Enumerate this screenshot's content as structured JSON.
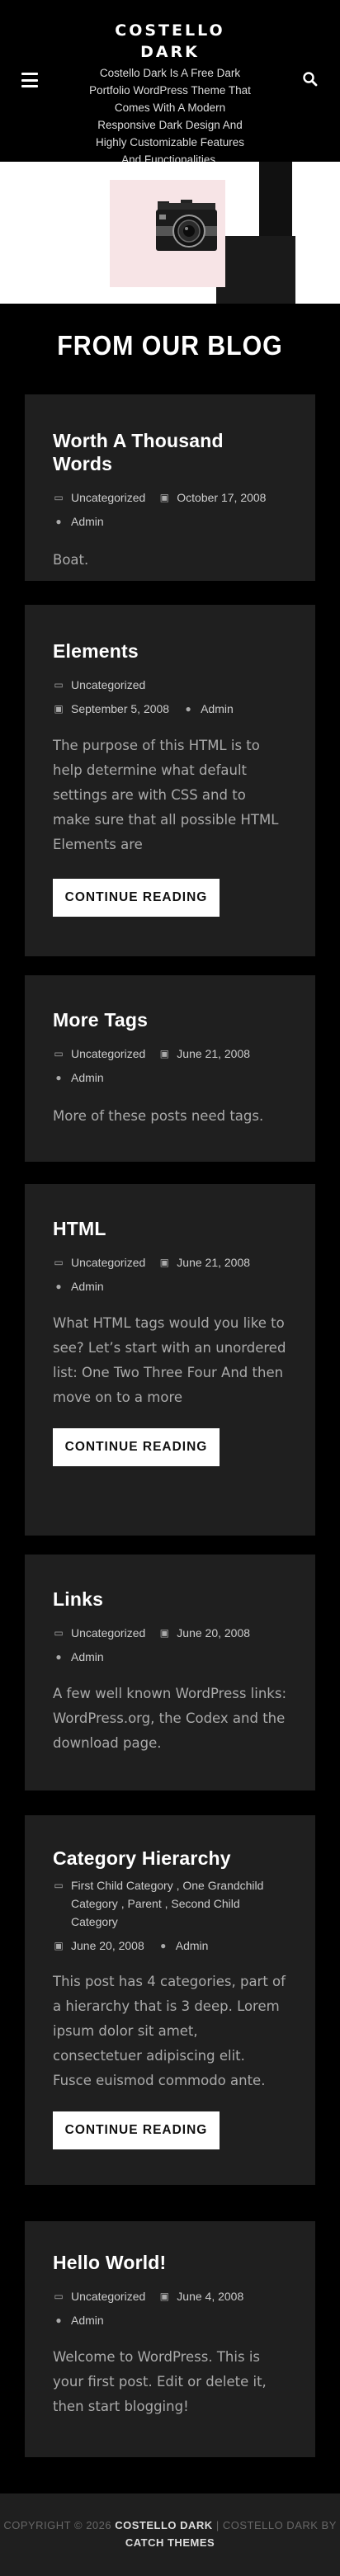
{
  "header": {
    "title": "COSTELLO DARK",
    "description": "Costello Dark Is A Free Dark Portfolio WordPress Theme That Comes With A Modern Responsive Dark Design And Highly Customizable Features And Functionalities.",
    "menu_icon": "menu-icon",
    "search_icon": "search-icon"
  },
  "blog": {
    "section_title": "FROM OUR BLOG",
    "read_more": "CONTINUE READING",
    "posts": [
      {
        "title": "Worth A Thousand Words",
        "category": "Uncategorized",
        "date": "October 17, 2008",
        "author": "Admin",
        "excerpt": "Boat."
      },
      {
        "title": "Elements",
        "category": "Uncategorized",
        "date": "September 5, 2008",
        "author": "Admin",
        "excerpt": "The purpose of this HTML is to help determine what default settings are with CSS and to make sure that all possible HTML Elements are"
      },
      {
        "title": "More Tags",
        "category": "Uncategorized",
        "date": "June 21, 2008",
        "author": "Admin",
        "excerpt": "More of these posts need tags."
      },
      {
        "title": "HTML",
        "category": "Uncategorized",
        "date": "June 21, 2008",
        "author": "Admin",
        "excerpt": "What HTML tags would you like to see? Let’s start with an unordered list: One Two Three Four And then move on to a more"
      },
      {
        "title": "Links",
        "category": "Uncategorized",
        "date": "June 20, 2008",
        "author": "Admin",
        "excerpt": "A few well known WordPress links: WordPress.org, the Codex and the download page."
      },
      {
        "title": "Category Hierarchy",
        "categories": [
          "First Child Category",
          "One Grandchild Category",
          "Parent",
          "Second Child Category"
        ],
        "date": "June 20, 2008",
        "author": "Admin",
        "excerpt": "This post has 4 categories, part of a hierarchy that is 3 deep. Lorem ipsum dolor sit amet, consectetuer adipiscing elit. Fusce euismod commodo ante."
      },
      {
        "title": "Hello World!",
        "category": "Uncategorized",
        "date": "June 4, 2008",
        "author": "Admin",
        "excerpt": "Welcome to WordPress. This is your first post. Edit or delete it, then start blogging!"
      }
    ]
  },
  "footer": {
    "copyright": "COPYRIGHT © 2026",
    "site_link": "COSTELLO DARK",
    "separator": "|",
    "theme_name": "COSTELLO DARK BY",
    "theme_author": "CATCH THEMES"
  }
}
